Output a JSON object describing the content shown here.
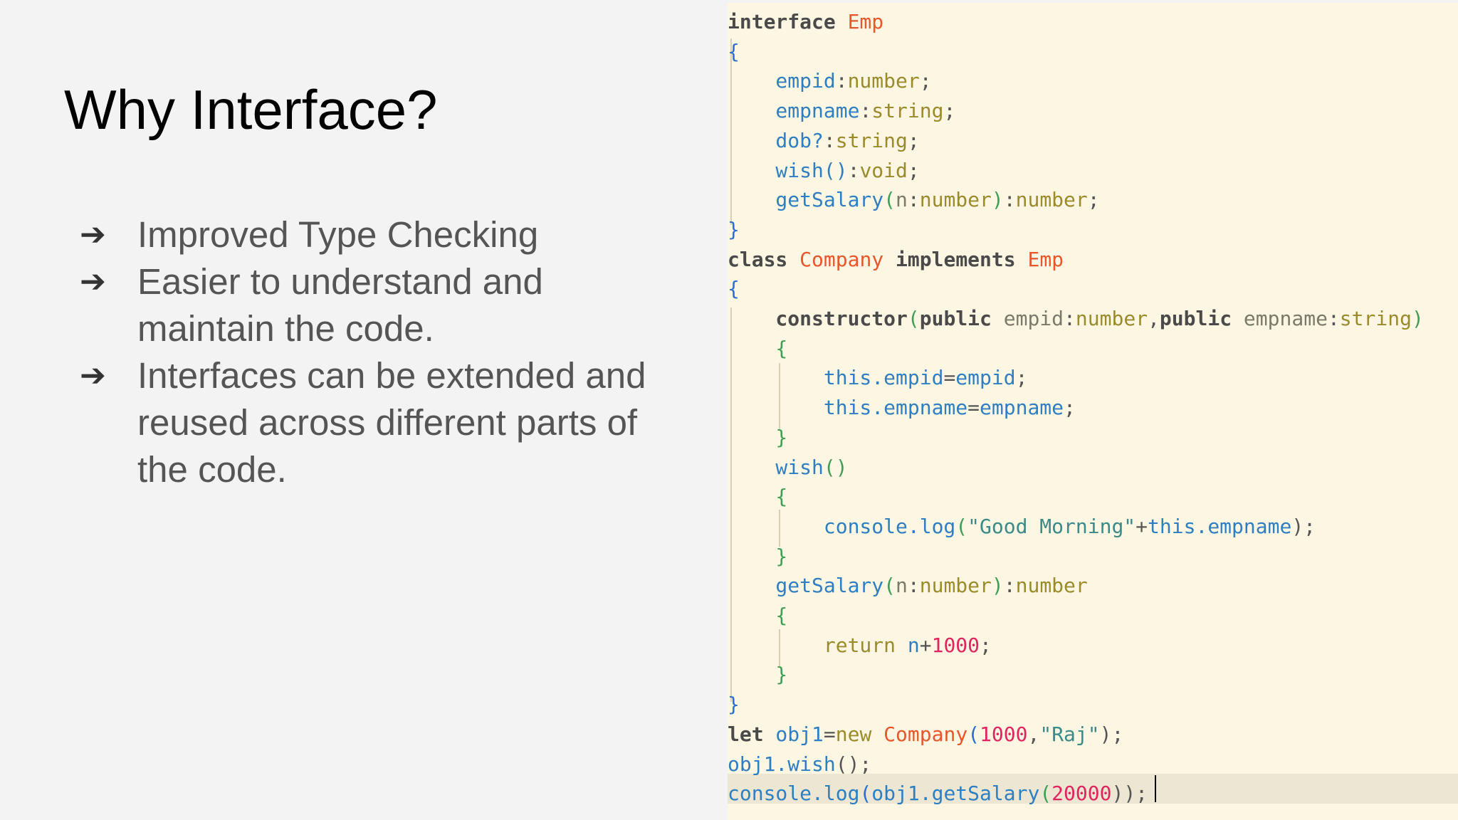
{
  "slide": {
    "title": "Why Interface?",
    "bullets": [
      {
        "arrow": "➔",
        "text": "Improved Type Checking"
      },
      {
        "arrow": "➔",
        "text": "Easier to understand and maintain the code."
      },
      {
        "arrow": "➔",
        "text": "Interfaces can be extended and reused across different parts of the code."
      }
    ]
  },
  "code": {
    "lines": [
      [
        {
          "t": "interface",
          "c": "kw"
        },
        {
          "t": " ",
          "c": "punc"
        },
        {
          "t": "Emp",
          "c": "type"
        }
      ],
      [
        {
          "t": "{",
          "c": "brace"
        }
      ],
      [
        {
          "t": "    empid",
          "c": "prop"
        },
        {
          "t": ":",
          "c": "punc"
        },
        {
          "t": "number",
          "c": "ptype"
        },
        {
          "t": ";",
          "c": "punc"
        }
      ],
      [
        {
          "t": "    empname",
          "c": "prop"
        },
        {
          "t": ":",
          "c": "punc"
        },
        {
          "t": "string",
          "c": "ptype"
        },
        {
          "t": ";",
          "c": "punc"
        }
      ],
      [
        {
          "t": "    dob?",
          "c": "prop"
        },
        {
          "t": ":",
          "c": "punc"
        },
        {
          "t": "string",
          "c": "ptype"
        },
        {
          "t": ";",
          "c": "punc"
        }
      ],
      [
        {
          "t": "    wish()",
          "c": "prop"
        },
        {
          "t": ":",
          "c": "punc"
        },
        {
          "t": "void",
          "c": "ptype"
        },
        {
          "t": ";",
          "c": "punc"
        }
      ],
      [
        {
          "t": "    getSalary",
          "c": "prop"
        },
        {
          "t": "(",
          "c": "brace2"
        },
        {
          "t": "n",
          "c": "param"
        },
        {
          "t": ":",
          "c": "punc"
        },
        {
          "t": "number",
          "c": "ptype"
        },
        {
          "t": ")",
          "c": "brace2"
        },
        {
          "t": ":",
          "c": "punc"
        },
        {
          "t": "number",
          "c": "ptype"
        },
        {
          "t": ";",
          "c": "punc"
        }
      ],
      [
        {
          "t": "}",
          "c": "brace"
        }
      ],
      [
        {
          "t": "class",
          "c": "kw"
        },
        {
          "t": " ",
          "c": "punc"
        },
        {
          "t": "Company",
          "c": "type"
        },
        {
          "t": " ",
          "c": "punc"
        },
        {
          "t": "implements",
          "c": "kw"
        },
        {
          "t": " ",
          "c": "punc"
        },
        {
          "t": "Emp",
          "c": "type"
        }
      ],
      [
        {
          "t": "{",
          "c": "brace"
        }
      ],
      [
        {
          "t": "    constructor",
          "c": "kw"
        },
        {
          "t": "(",
          "c": "brace2"
        },
        {
          "t": "public",
          "c": "kw"
        },
        {
          "t": " empid",
          "c": "param"
        },
        {
          "t": ":",
          "c": "punc"
        },
        {
          "t": "number",
          "c": "ptype"
        },
        {
          "t": ",",
          "c": "punc"
        },
        {
          "t": "public",
          "c": "kw"
        },
        {
          "t": " empname",
          "c": "param"
        },
        {
          "t": ":",
          "c": "punc"
        },
        {
          "t": "string",
          "c": "ptype"
        },
        {
          "t": ")",
          "c": "brace2"
        }
      ],
      [
        {
          "t": "    {",
          "c": "brace2"
        }
      ],
      [
        {
          "t": "        this.empid",
          "c": "prop"
        },
        {
          "t": "=",
          "c": "punc"
        },
        {
          "t": "empid",
          "c": "prop"
        },
        {
          "t": ";",
          "c": "punc"
        }
      ],
      [
        {
          "t": "        this.empname",
          "c": "prop"
        },
        {
          "t": "=",
          "c": "punc"
        },
        {
          "t": "empname",
          "c": "prop"
        },
        {
          "t": ";",
          "c": "punc"
        }
      ],
      [
        {
          "t": "    }",
          "c": "brace2"
        }
      ],
      [
        {
          "t": "    wish",
          "c": "prop"
        },
        {
          "t": "()",
          "c": "brace2"
        }
      ],
      [
        {
          "t": "    {",
          "c": "brace2"
        }
      ],
      [
        {
          "t": "        console.log",
          "c": "call"
        },
        {
          "t": "(",
          "c": "brace2"
        },
        {
          "t": "\"Good Morning\"",
          "c": "str"
        },
        {
          "t": "+",
          "c": "punc"
        },
        {
          "t": "this.empname",
          "c": "prop"
        },
        {
          "t": ");",
          "c": "punc"
        }
      ],
      [
        {
          "t": "    }",
          "c": "brace2"
        }
      ],
      [
        {
          "t": "    getSalary",
          "c": "prop"
        },
        {
          "t": "(",
          "c": "brace2"
        },
        {
          "t": "n",
          "c": "param"
        },
        {
          "t": ":",
          "c": "punc"
        },
        {
          "t": "number",
          "c": "ptype"
        },
        {
          "t": ")",
          "c": "brace2"
        },
        {
          "t": ":",
          "c": "punc"
        },
        {
          "t": "number",
          "c": "ptype"
        }
      ],
      [
        {
          "t": "    {",
          "c": "brace2"
        }
      ],
      [
        {
          "t": "        return",
          "c": "ptype"
        },
        {
          "t": " n",
          "c": "prop"
        },
        {
          "t": "+",
          "c": "punc"
        },
        {
          "t": "1000",
          "c": "num"
        },
        {
          "t": ";",
          "c": "punc"
        }
      ],
      [
        {
          "t": "    }",
          "c": "brace2"
        }
      ],
      [
        {
          "t": "}",
          "c": "brace"
        }
      ],
      [
        {
          "t": "let",
          "c": "kw"
        },
        {
          "t": " obj1",
          "c": "prop"
        },
        {
          "t": "=",
          "c": "punc"
        },
        {
          "t": "new",
          "c": "ptype"
        },
        {
          "t": " ",
          "c": "punc"
        },
        {
          "t": "Company",
          "c": "type"
        },
        {
          "t": "(",
          "c": "brace"
        },
        {
          "t": "1000",
          "c": "num"
        },
        {
          "t": ",",
          "c": "punc"
        },
        {
          "t": "\"Raj\"",
          "c": "str"
        },
        {
          "t": ");",
          "c": "punc"
        }
      ],
      [
        {
          "t": "obj1.wish",
          "c": "call"
        },
        {
          "t": "();",
          "c": "punc"
        }
      ],
      [
        {
          "t": "console.log",
          "c": "call"
        },
        {
          "t": "(",
          "c": "brace"
        },
        {
          "t": "obj1.getSalary",
          "c": "call"
        },
        {
          "t": "(",
          "c": "brace2"
        },
        {
          "t": "20000",
          "c": "num"
        },
        {
          "t": "));",
          "c": "punc"
        }
      ]
    ]
  }
}
